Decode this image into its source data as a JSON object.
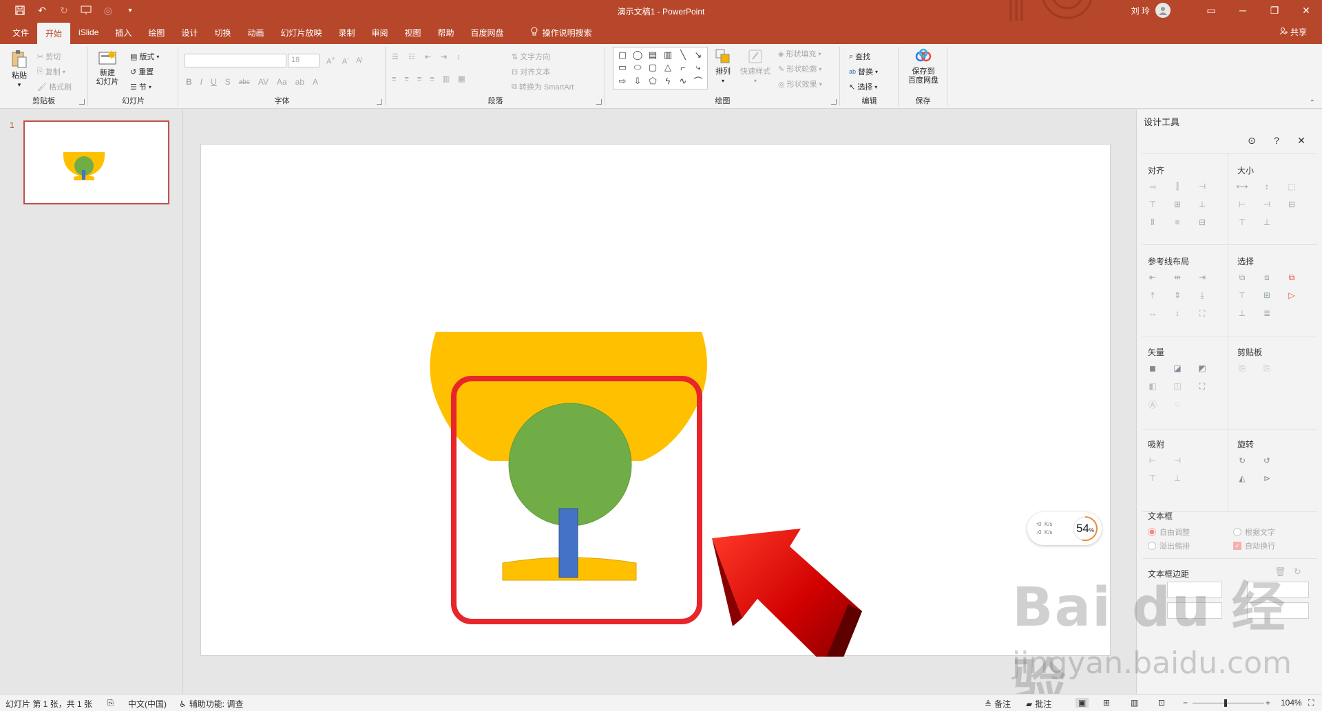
{
  "window": {
    "title": "演示文稿1  -  PowerPoint",
    "user_name": "刘 玲"
  },
  "tabs": [
    "文件",
    "开始",
    "iSlide",
    "插入",
    "绘图",
    "设计",
    "切换",
    "动画",
    "幻灯片放映",
    "录制",
    "审阅",
    "视图",
    "帮助",
    "百度网盘"
  ],
  "active_tab": "开始",
  "tell_me": "操作说明搜索",
  "share_label": "共享",
  "ribbon": {
    "clipboard": {
      "label": "剪贴板",
      "paste": "粘贴",
      "cut": "剪切",
      "copy": "复制",
      "format_painter": "格式刷"
    },
    "slides": {
      "label": "幻灯片",
      "new_slide_line1": "新建",
      "new_slide_line2": "幻灯片",
      "layout": "版式",
      "reset": "重置",
      "section": "节"
    },
    "font": {
      "label": "字体",
      "size": "18"
    },
    "paragraph": {
      "label": "段落",
      "text_direction": "文字方向",
      "align_text": "对齐文本",
      "smartart": "转换为 SmartArt"
    },
    "drawing": {
      "label": "绘图",
      "arrange": "排列",
      "quick_styles": "快速样式",
      "shape_fill": "形状填充",
      "shape_outline": "形状轮廓",
      "shape_effects": "形状效果"
    },
    "editing": {
      "label": "编辑",
      "find": "查找",
      "replace": "替换",
      "select": "选择"
    },
    "save": {
      "label": "保存",
      "save_to_line1": "保存到",
      "save_to_line2": "百度网盘"
    }
  },
  "slide_pane": {
    "slide_number": "1"
  },
  "design_tools": {
    "title": "设计工具",
    "sections": {
      "align": "对齐",
      "size": "大小",
      "guides": "参考线布局",
      "select": "选择",
      "vector": "矢量",
      "clipboard": "剪贴板",
      "snap": "吸附",
      "rotate": "旋转",
      "textbox": "文本框",
      "textbox_margin": "文本框边距"
    },
    "textbox_options": {
      "auto_adjust": "自由调整",
      "fit_text": "根据文字",
      "overflow_shrink": "溢出缩排",
      "auto_wrap": "自动换行"
    }
  },
  "net_widget": {
    "up": "0",
    "down": "0",
    "unit": "K/s",
    "percent": "54",
    "percent_sign": "%"
  },
  "status_bar": {
    "slide_info": "幻灯片 第 1 张，共 1 张",
    "language": "中文(中国)",
    "accessibility": "辅助功能: 调查",
    "notes": "备注",
    "comments": "批注",
    "zoom": "104%"
  },
  "watermark": {
    "line1": "Bai du 经验",
    "line2": "jingyan.baidu.com"
  },
  "colors": {
    "accent": "#b7472a",
    "goblet_yellow": "#ffc000",
    "goblet_green": "#70ad47",
    "goblet_blue": "#4472c4",
    "highlight_red": "#e8252b"
  }
}
